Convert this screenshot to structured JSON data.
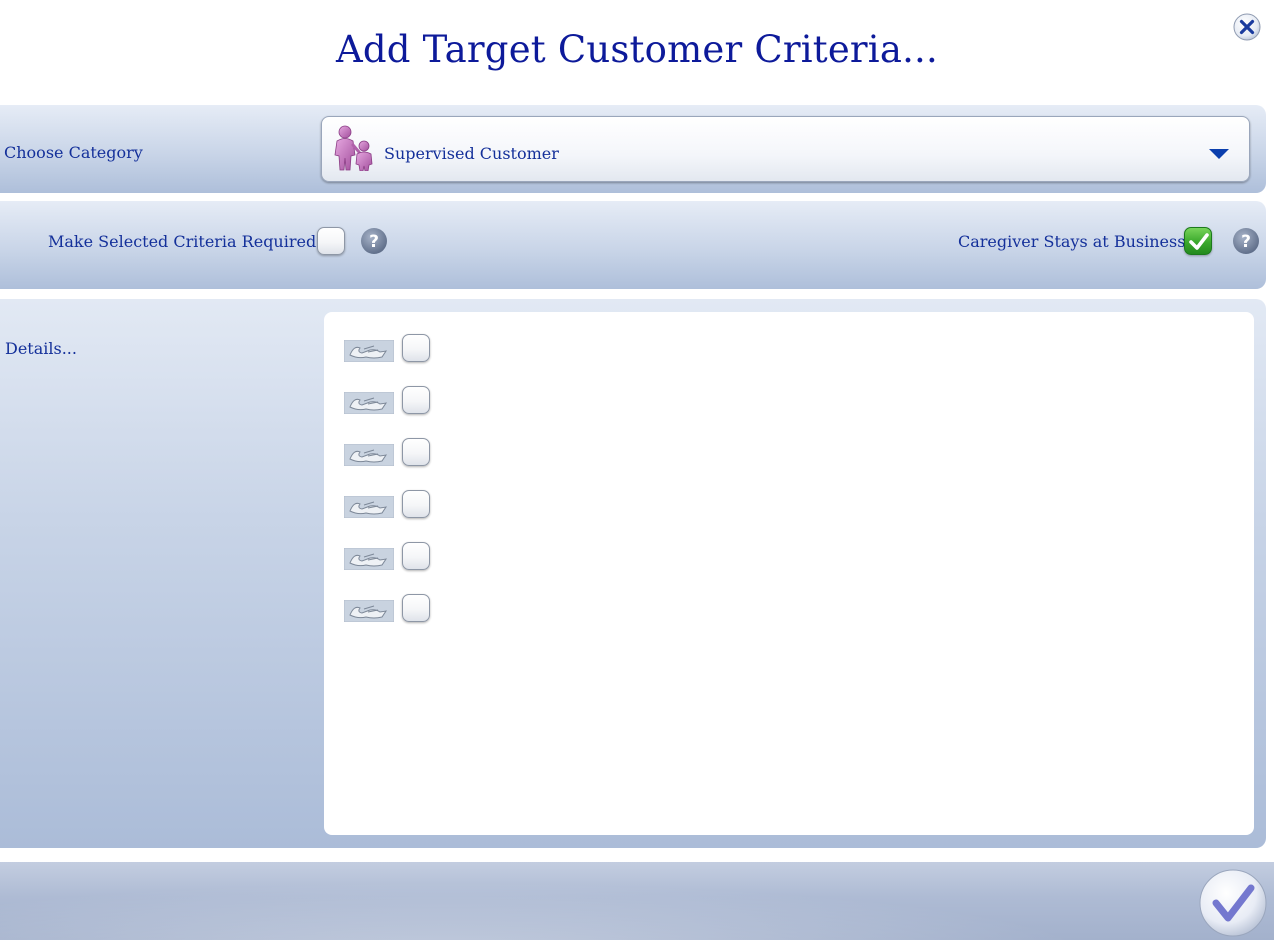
{
  "dialog": {
    "title": "Add Target Customer Criteria..."
  },
  "category": {
    "label": "Choose Category",
    "selected_value": "Supervised Customer",
    "selected_icon": "supervised-customer-icon"
  },
  "options": {
    "required_label": "Make Selected Criteria Required",
    "required_checked": false,
    "caregiver_label": "Caregiver Stays at Business",
    "caregiver_checked": true
  },
  "details": {
    "label": "Details...",
    "items": [
      {
        "image": "broken-image-icon",
        "checked": false
      },
      {
        "image": "broken-image-icon",
        "checked": false
      },
      {
        "image": "broken-image-icon",
        "checked": false
      },
      {
        "image": "broken-image-icon",
        "checked": false
      },
      {
        "image": "broken-image-icon",
        "checked": false
      },
      {
        "image": "broken-image-icon",
        "checked": false
      }
    ]
  },
  "colors": {
    "text": "#14309a",
    "title": "#0d1a9a",
    "check_green": "#3aa82c"
  }
}
